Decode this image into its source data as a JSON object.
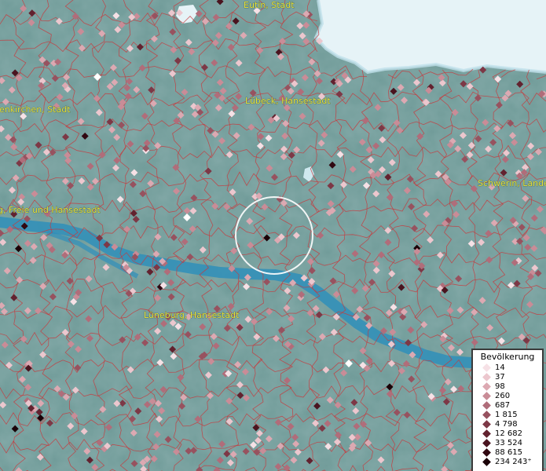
{
  "map": {
    "style": "population choropleth over terrain basemap",
    "colors": {
      "land": "#6f9a98",
      "land_dark": "#5f8a88",
      "sea": "#e7f3f7",
      "river": "#2f8fba",
      "boundary": "#c8383c",
      "label": "#e8e23a"
    },
    "labels": [
      {
        "id": "eutin",
        "text": "Eutin, Stadt"
      },
      {
        "id": "luebeck",
        "text": "Lübeck, Hansestadt"
      },
      {
        "id": "schwerin",
        "text": "Schwerin, Landes"
      },
      {
        "id": "hamburg",
        "text": "g, Freie und Hansestadt"
      },
      {
        "id": "lueneburg",
        "text": "Lüneburg, Hansestadt"
      },
      {
        "id": "quickborn",
        "text": "enkirchen, Stadt"
      }
    ]
  },
  "legend": {
    "title": "Bevölkerung",
    "items": [
      {
        "label": "14",
        "color": "#f6e1e6"
      },
      {
        "label": "37",
        "color": "#ecc7ce"
      },
      {
        "label": "98",
        "color": "#dca9b2"
      },
      {
        "label": "260",
        "color": "#c98c97"
      },
      {
        "label": "687",
        "color": "#b06d7a"
      },
      {
        "label": "1 815",
        "color": "#97525f"
      },
      {
        "label": "4 798",
        "color": "#7d3846"
      },
      {
        "label": "12 682",
        "color": "#62222f"
      },
      {
        "label": "33 524",
        "color": "#4a141f"
      },
      {
        "label": "88 615",
        "color": "#310811"
      },
      {
        "label": "234 243⁺",
        "color": "#1a0207"
      }
    ]
  }
}
